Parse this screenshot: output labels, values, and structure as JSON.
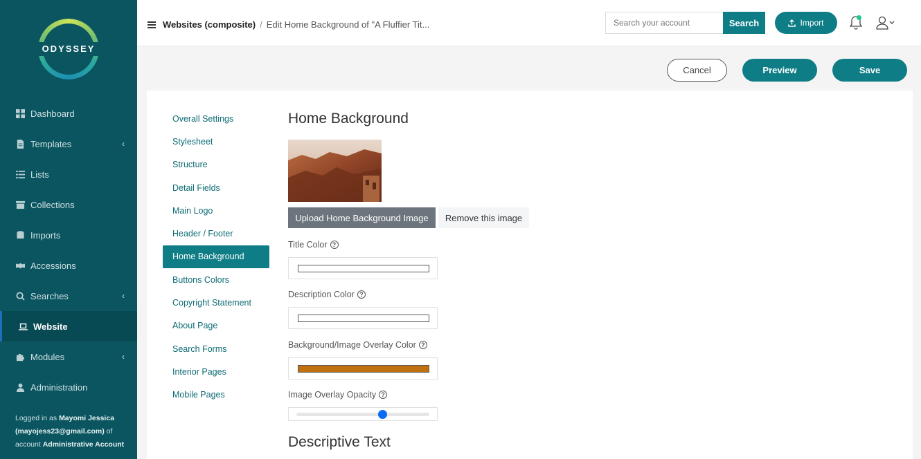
{
  "brand": {
    "name": "ODYSSEY"
  },
  "sidebar": {
    "items": [
      {
        "label": "Dashboard",
        "icon": "dashboard-icon",
        "has_chevron": false
      },
      {
        "label": "Templates",
        "icon": "file-icon",
        "has_chevron": true
      },
      {
        "label": "Lists",
        "icon": "list-icon",
        "has_chevron": false
      },
      {
        "label": "Collections",
        "icon": "archive-icon",
        "has_chevron": false
      },
      {
        "label": "Imports",
        "icon": "database-icon",
        "has_chevron": false
      },
      {
        "label": "Accessions",
        "icon": "handshake-icon",
        "has_chevron": false
      },
      {
        "label": "Searches",
        "icon": "search-icon",
        "has_chevron": true
      },
      {
        "label": "Website",
        "icon": "laptop-icon",
        "has_chevron": false,
        "active": true
      },
      {
        "label": "Modules",
        "icon": "puzzle-icon",
        "has_chevron": true
      },
      {
        "label": "Administration",
        "icon": "user-icon",
        "has_chevron": false
      }
    ],
    "login": {
      "prefix": "Logged in as",
      "name": "Mayomi Jessica",
      "email": "(mayojess23@gmail.com)",
      "of_account": "of account",
      "account": "Administrative Account"
    }
  },
  "header": {
    "breadcrumb_root": "Websites (composite)",
    "breadcrumb_sep": "/",
    "breadcrumb_current": "Edit Home Background of \"A Fluffier Tit...",
    "search_placeholder": "Search your account",
    "search_label": "Search",
    "import_label": "Import"
  },
  "actions": {
    "cancel": "Cancel",
    "preview": "Preview",
    "save": "Save"
  },
  "subnav": [
    "Overall Settings",
    "Stylesheet",
    "Structure",
    "Detail Fields",
    "Main Logo",
    "Header / Footer",
    "Home Background",
    "Buttons Colors",
    "Copyright Statement",
    "About Page",
    "Search Forms",
    "Interior Pages",
    "Mobile Pages"
  ],
  "subnav_active": "Home Background",
  "main": {
    "title": "Home Background",
    "upload_label": "Upload Home Background Image",
    "remove_label": "Remove this image",
    "title_color_label": "Title Color",
    "title_color": "#ffffff",
    "description_color_label": "Description Color",
    "description_color": "#ffffff",
    "overlay_color_label": "Background/Image Overlay Color",
    "overlay_color": "#c0700f",
    "opacity_label": "Image Overlay Opacity",
    "opacity_value": 0.65,
    "section2_title": "Descriptive Text",
    "help_symbol": "?"
  },
  "colors": {
    "primary": "#0e7d86",
    "sidebar": "#0a5560"
  }
}
